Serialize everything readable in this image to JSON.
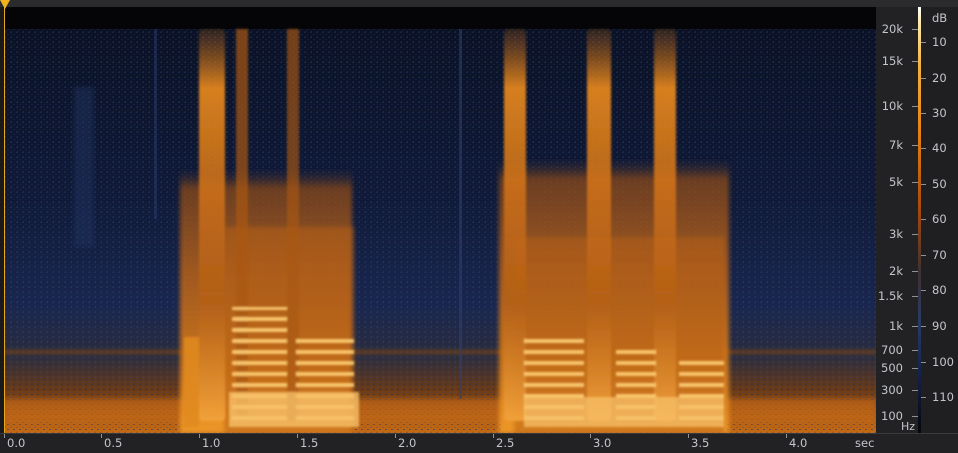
{
  "app": {
    "view": "spectral-frequency-display"
  },
  "time_axis": {
    "labels": [
      "0.0",
      "0.5",
      "1.0",
      "1.5",
      "2.0",
      "2.5",
      "3.0",
      "3.5",
      "4.0"
    ],
    "unit": "sec"
  },
  "frequency_axis": {
    "labels": [
      "20k",
      "15k",
      "10k",
      "7k",
      "5k",
      "3k",
      "2k",
      "1.5k",
      "1k",
      "700",
      "500",
      "300",
      "100"
    ],
    "unit": "Hz"
  },
  "amplitude_scale": {
    "unit": "dB",
    "labels": [
      "10",
      "20",
      "30",
      "40",
      "50",
      "60",
      "70",
      "80",
      "90",
      "100",
      "110"
    ]
  },
  "colors": {
    "accent": "#f0b21e",
    "hot": "#ffd27a",
    "mid": "#e07a15",
    "cold": "#1c2b58",
    "background": "#07070a"
  }
}
